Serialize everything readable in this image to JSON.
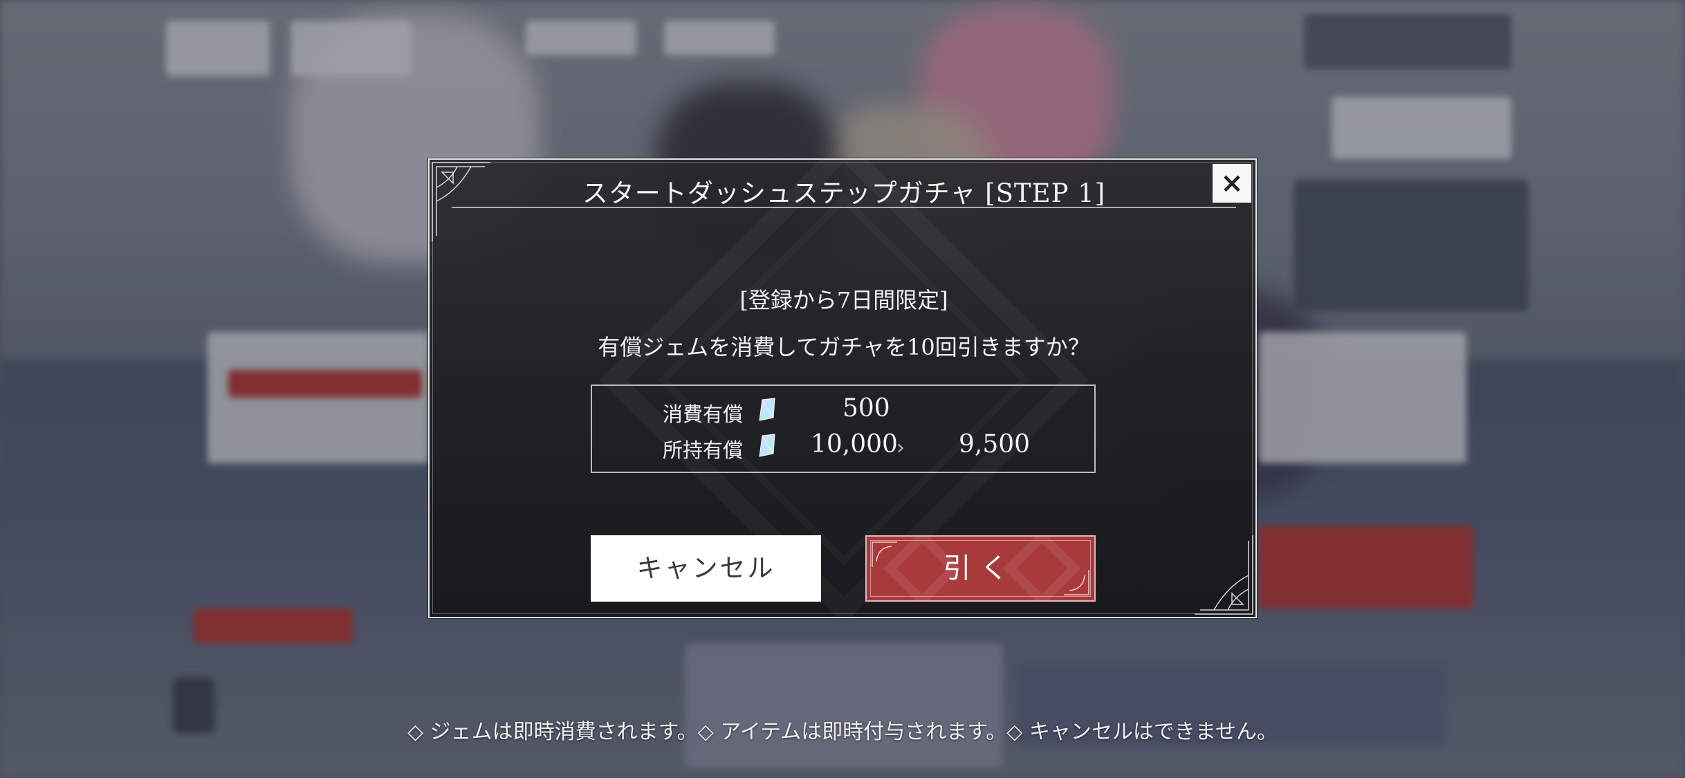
{
  "dialog": {
    "title": "スタートダッシュステップガチャ [STEP 1]",
    "close_label": "×",
    "limited_note": "[登録から7日間限定]",
    "question": "有償ジェムを消費してガチャを10回引きますか？",
    "cost": {
      "label": "消費有償",
      "value": "500"
    },
    "owned": {
      "label": "所持有償",
      "before": "10,000",
      "arrow": "›",
      "after": "9,500"
    },
    "gem_icon": "gem-icon",
    "cancel_label": "キャンセル",
    "draw_label": "引く"
  },
  "footer_note": "◇ ジェムは即時消費されます。◇ アイテムは即時付与されます。◇ キャンセルはできません。",
  "colors": {
    "draw_button": "#a93a3c",
    "cancel_button": "#ffffff",
    "dialog_bg": "#1c1c20"
  }
}
